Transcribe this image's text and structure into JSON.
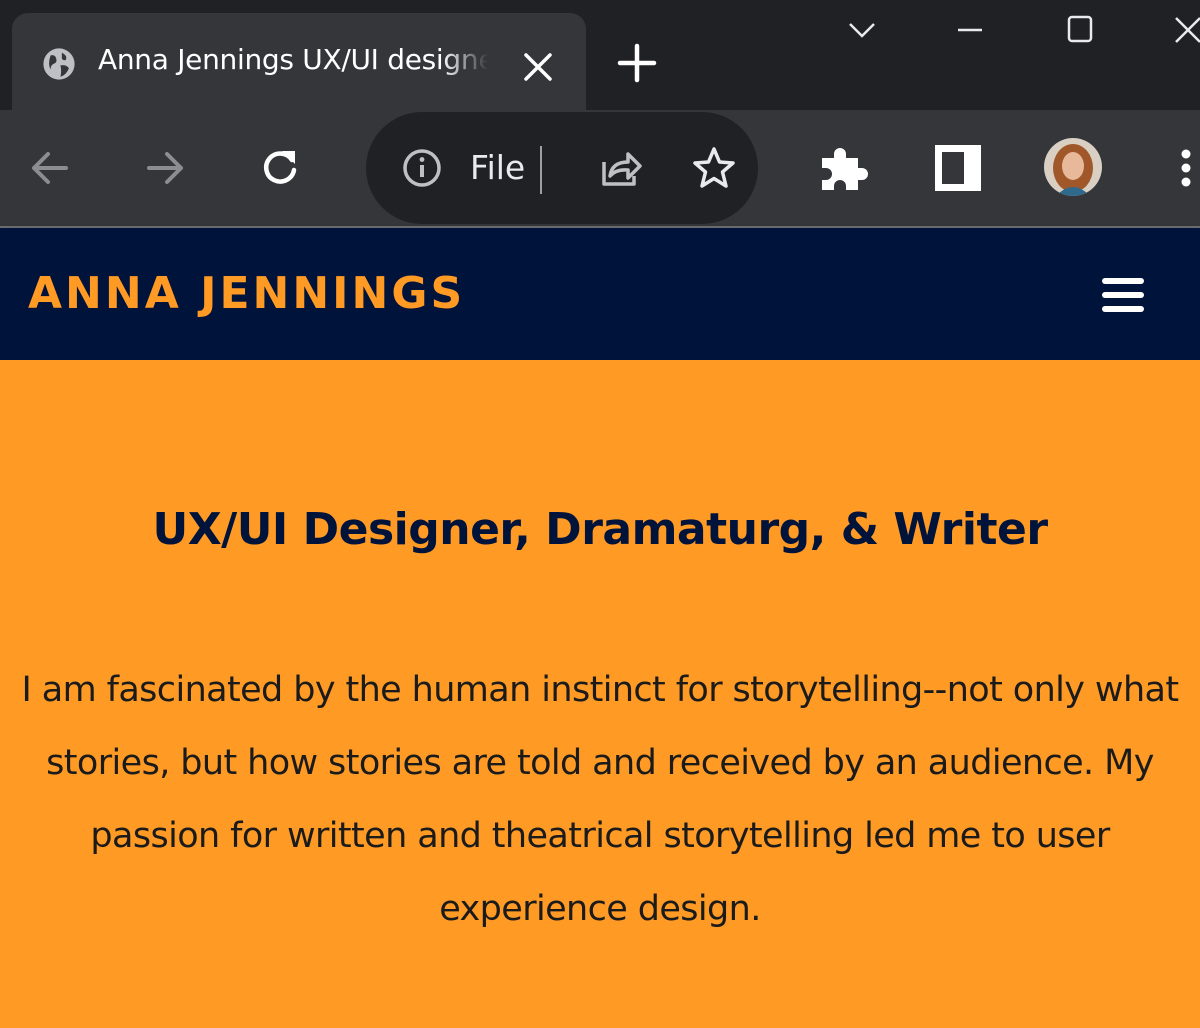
{
  "browser": {
    "tab": {
      "title": "Anna Jennings UX/UI designer",
      "favicon": "globe-icon"
    },
    "new_tab_icon": "plus-icon",
    "window_controls": [
      "chevron-down-icon",
      "minimize-icon",
      "maximize-icon",
      "close-icon"
    ],
    "toolbar": {
      "back_icon": "back-arrow-icon",
      "forward_icon": "forward-arrow-icon",
      "reload_icon": "reload-icon",
      "address": {
        "scheme_label": "File",
        "info_icon": "info-icon"
      },
      "share_icon": "share-icon",
      "bookmark_icon": "star-icon",
      "extensions_icon": "puzzle-icon",
      "side_panel_icon": "side-panel-icon",
      "profile_icon": "avatar",
      "menu_icon": "kebab-menu-icon"
    }
  },
  "site": {
    "logo": "ANNA JENNINGS",
    "menu_icon": "hamburger-icon",
    "hero": {
      "title": "UX/UI Designer, Dramaturg, & Writer",
      "intro": "I am fascinated by the human instinct for storytelling--not only what stories, but how stories are told and received by an audience. My passion for written and theatrical storytelling led me to user experience design."
    }
  },
  "colors": {
    "accent_orange": "#ff9a24",
    "navy": "#00133b",
    "chrome_dark": "#202124",
    "chrome_mid": "#35363a"
  }
}
